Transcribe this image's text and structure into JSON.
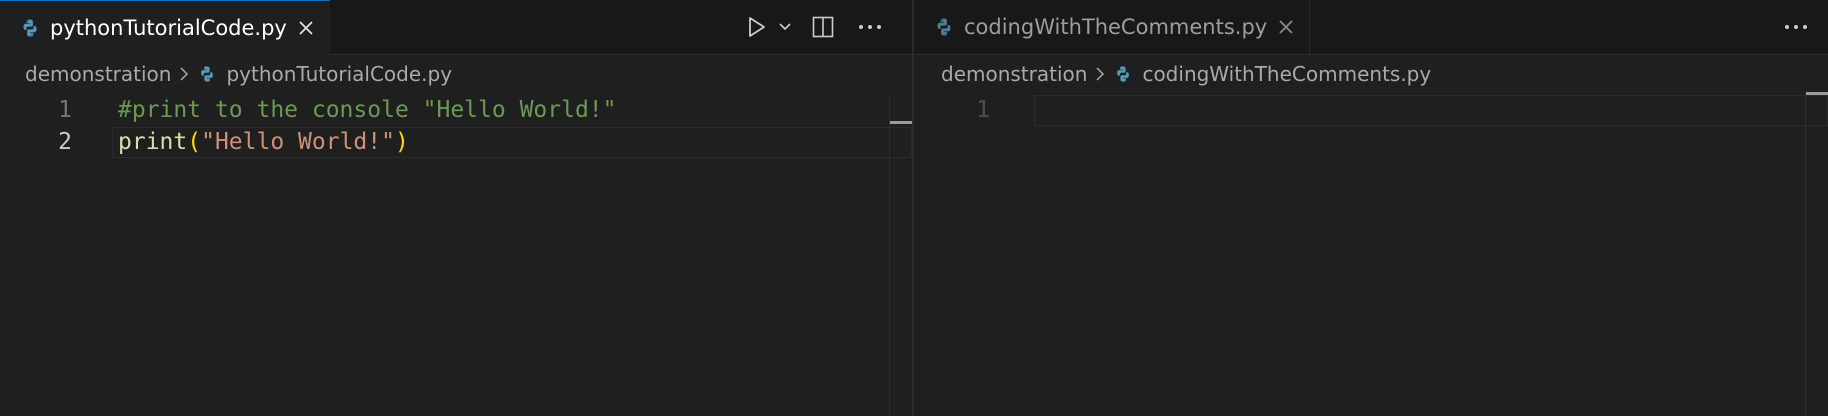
{
  "left_pane": {
    "tab": {
      "label": "pythonTutorialCode.py",
      "icon": "python-icon"
    },
    "actions": {
      "run": "play-icon",
      "run_menu": "chevron-down-icon",
      "split": "split-editor-icon",
      "more": "ellipsis-icon"
    },
    "breadcrumb": {
      "folder": "demonstration",
      "file": "pythonTutorialCode.py"
    },
    "lines": [
      {
        "number": "1",
        "comment": "#print to the console \"Hello World!\""
      },
      {
        "number": "2",
        "func": "print",
        "open": "(",
        "string": "\"Hello World!\"",
        "close": ")"
      }
    ]
  },
  "right_pane": {
    "tab": {
      "label": "codingWithTheComments.py",
      "icon": "python-icon"
    },
    "actions": {
      "more": "ellipsis-icon"
    },
    "breadcrumb": {
      "folder": "demonstration",
      "file": "codingWithTheComments.py"
    },
    "lines": [
      {
        "number": "1"
      }
    ]
  },
  "colors": {
    "background": "#1f1f1f",
    "tabbar": "#181818",
    "comment": "#6a9955",
    "function": "#dcdcaa",
    "bracket": "#ffd700",
    "string": "#ce9178",
    "python_icon": "#519aba"
  }
}
